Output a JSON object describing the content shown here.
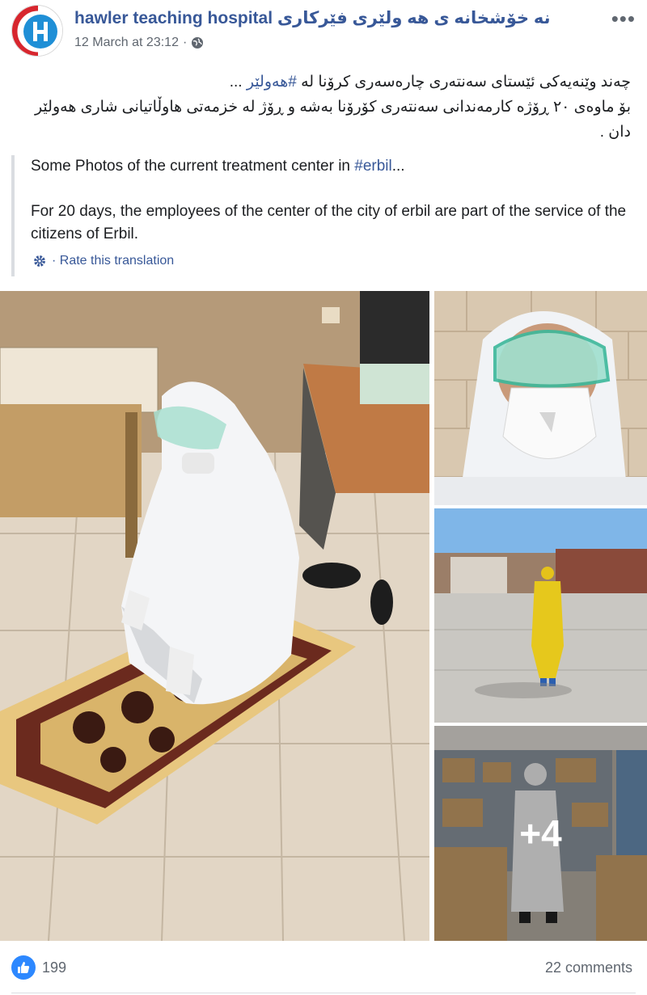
{
  "post": {
    "page_name": "hawler teaching hospital نه خۆشخانه ی هه ولێری فێرکاری",
    "timestamp": "12 March at 23:12",
    "privacy_icon": "globe-icon",
    "more_icon": "more-options-icon",
    "kurdish_text": {
      "line1_prefix": "چەند وێنەیەکی ئێستای سەنتەری چارەسەری کرۆنا لە ",
      "line1_hashtag": "#هەولێر",
      "line1_suffix": " ...",
      "line2": "بۆ ماوەی ٢٠ ڕۆژە کارمەندانی سەنتەری کۆرۆنا بەشە و ڕۆژ لە خزمەتی هاوڵاتیانی شاری هەولێر دان ."
    },
    "translation": {
      "line1_prefix": "Some Photos of the current treatment center in ",
      "line1_hashtag": "#erbil",
      "line1_suffix": "...",
      "paragraph2": "For 20 days, the employees of the center of the city of erbil are part of the service of the citizens of Erbil.",
      "rate_label": "· Rate this translation",
      "rate_icon": "gear-icon"
    },
    "photos": {
      "extra_count": "+4"
    },
    "reactions": {
      "like_icon": "like-icon",
      "count": "199",
      "comments": "22 comments"
    }
  },
  "colors": {
    "link": "#385898",
    "meta": "#606770",
    "like_badge": "#2d88ff",
    "divider": "#dadde1"
  }
}
